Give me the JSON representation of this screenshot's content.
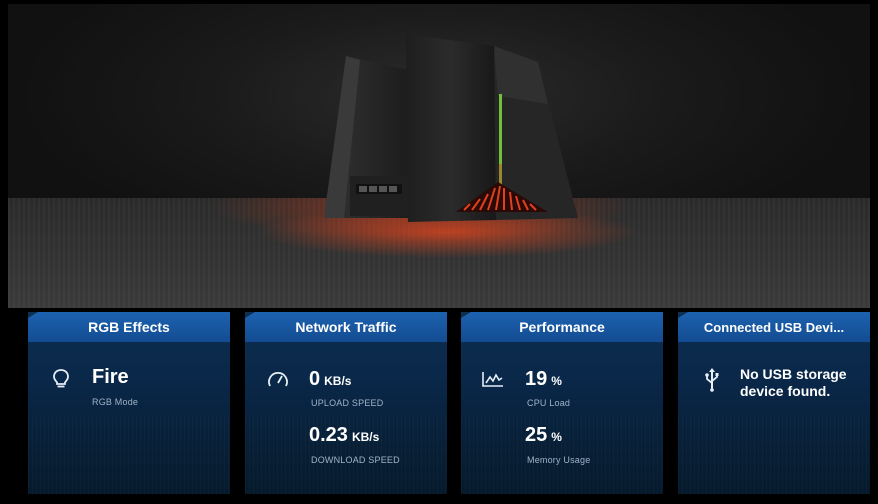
{
  "cards": {
    "rgb": {
      "title": "RGB Effects",
      "icon": "lightbulb-icon",
      "value": "Fire",
      "label": "RGB Mode"
    },
    "network": {
      "title": "Network Traffic",
      "icon": "speedometer-icon",
      "upload_value": "0",
      "upload_unit": "KB/s",
      "upload_label": "UPLOAD SPEED",
      "download_value": "0.23",
      "download_unit": "KB/s",
      "download_label": "DOWNLOAD SPEED"
    },
    "performance": {
      "title": "Performance",
      "icon": "line-chart-icon",
      "cpu_value": "19",
      "cpu_unit": "%",
      "cpu_label": "CPU Load",
      "memory_value": "25",
      "memory_unit": "%",
      "memory_label": "Memory Usage"
    },
    "usb": {
      "title": "Connected USB Devi...",
      "icon": "usb-icon",
      "message": "No USB storage device found."
    }
  },
  "colors": {
    "card_header": "#1d62b0",
    "card_body": "#0a2748",
    "router_glow": "#d2401e",
    "router_led": "#7bd23a"
  }
}
